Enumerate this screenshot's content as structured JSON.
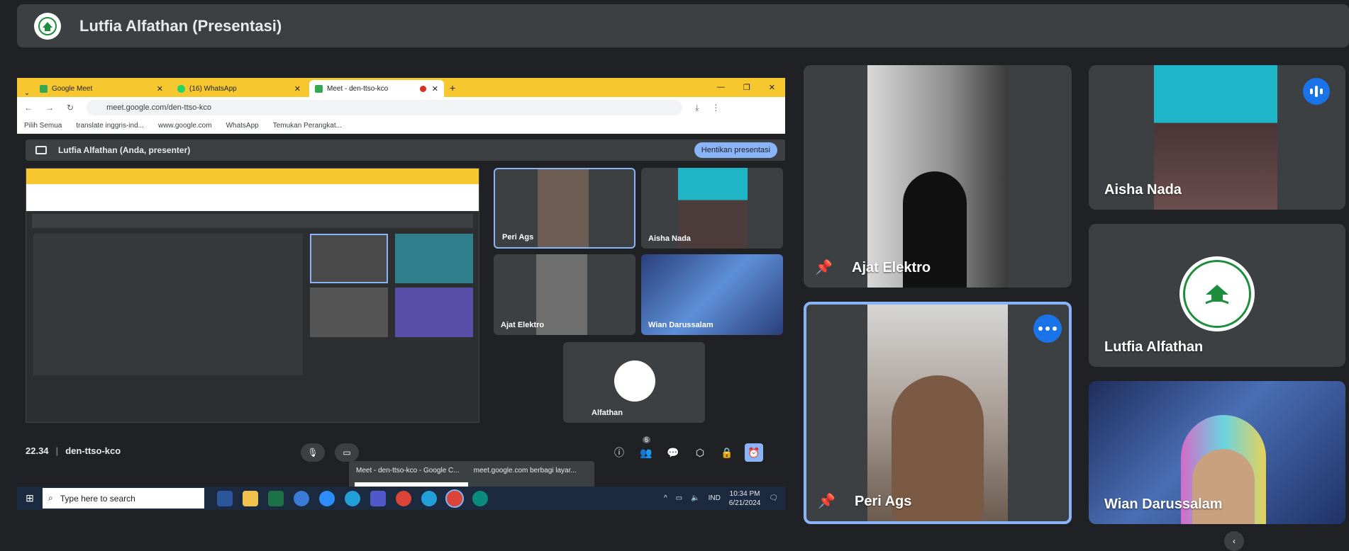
{
  "presenter_bar": {
    "title": "Lutfia Alfathan (Presentasi)",
    "logo_icon": "yayasan-logo-icon"
  },
  "shared_screen": {
    "tabs": [
      {
        "label": "Google Meet",
        "icon": "google-meet-icon"
      },
      {
        "label": "(16) WhatsApp",
        "icon": "whatsapp-icon"
      },
      {
        "label": "Meet - den-ttso-kco",
        "icon": "google-meet-icon"
      }
    ],
    "url": "meet.google.com/den-ttso-kco",
    "bookmarks": [
      "Pilih Semua",
      "translate inggris-ind...",
      "www.google.com",
      "WhatsApp",
      "Temukan Perangkat..."
    ],
    "inner_title": "Lutfia Alfathan (Anda, presenter)",
    "stop_button": "Hentikan presentasi",
    "mini_tiles": [
      "Peri Ags",
      "Aisha Nada",
      "Ajat Elektro",
      "Wian Darussalam",
      "Alfathan"
    ],
    "time": "22.34",
    "meeting_code": "den-ttso-kco",
    "participant_count": "6",
    "popup": {
      "item1": "Meet - den-ttso-kco - Google C...",
      "item2": "meet.google.com berbagi layar..."
    },
    "taskbar": {
      "search_placeholder": "Type here to search",
      "lang": "IND",
      "clock_time": "10:34 PM",
      "clock_date": "6/21/2024"
    }
  },
  "participants": [
    {
      "name": "Ajat Elektro",
      "pinned": true
    },
    {
      "name": "Aisha Nada",
      "speaking": true
    },
    {
      "name": "Peri Ags",
      "pinned": true,
      "active": true
    },
    {
      "name": "Lutfia Alfathan"
    },
    {
      "name": "Wian Darussalam"
    }
  ],
  "colors": {
    "accent": "#1a73e8",
    "highlight": "#8ab4f8",
    "tile": "#3c4043",
    "background": "#202124",
    "chrome_yellow": "#f6c72f"
  }
}
